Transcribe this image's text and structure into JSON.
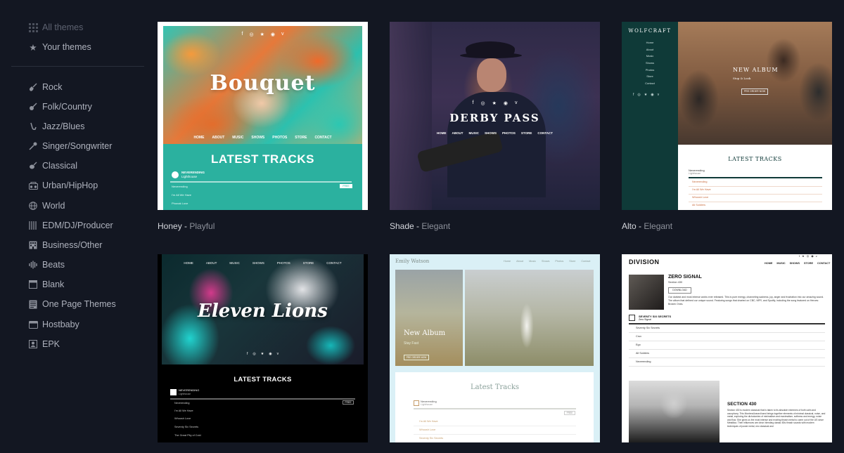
{
  "sidebar": {
    "top": [
      {
        "label": "All themes",
        "icon": "grid-icon"
      },
      {
        "label": "Your themes",
        "icon": "star-icon"
      }
    ],
    "genres": [
      {
        "label": "Rock",
        "icon": "electric-guitar-icon"
      },
      {
        "label": "Folk/Country",
        "icon": "acoustic-guitar-icon"
      },
      {
        "label": "Jazz/Blues",
        "icon": "saxophone-icon"
      },
      {
        "label": "Singer/Songwriter",
        "icon": "microphone-icon"
      },
      {
        "label": "Classical",
        "icon": "violin-icon"
      },
      {
        "label": "Urban/HipHop",
        "icon": "boombox-icon"
      },
      {
        "label": "World",
        "icon": "globe-icon"
      },
      {
        "label": "EDM/DJ/Producer",
        "icon": "mixer-icon"
      },
      {
        "label": "Business/Other",
        "icon": "building-icon"
      },
      {
        "label": "Beats",
        "icon": "waveform-icon"
      },
      {
        "label": "Blank",
        "icon": "blank-page-icon"
      },
      {
        "label": "One Page Themes",
        "icon": "single-page-icon"
      },
      {
        "label": "Hostbaby",
        "icon": "hostbaby-icon"
      },
      {
        "label": "EPK",
        "icon": "id-card-icon"
      }
    ]
  },
  "themes": {
    "honey": {
      "name": "Honey",
      "style": "Playful",
      "preview": {
        "title": "Bouquet",
        "nav": [
          "HOME",
          "ABOUT",
          "MUSIC",
          "SHOWS",
          "PHOTOS",
          "STORE",
          "CONTACT"
        ],
        "section_title": "LATEST TRACKS",
        "player_title": "NEVERENDING",
        "player_sub": "Lighthouse",
        "free_label": "FREE",
        "tracks": [
          "Neverending",
          "I'm All We Have",
          "Phonak Love"
        ]
      }
    },
    "shade": {
      "name": "Shade",
      "style": "Elegant",
      "preview": {
        "title": "DERBY PASS",
        "nav": [
          "HOME",
          "ABOUT",
          "MUSIC",
          "SHOWS",
          "PHOTOS",
          "STORE",
          "CONTACT"
        ]
      }
    },
    "alto": {
      "name": "Alto",
      "style": "Elegant",
      "preview": {
        "brand": "WOLFCRAFT",
        "menu": [
          "Home",
          "About",
          "Music",
          "Shows",
          "Photos",
          "Store",
          "Contact"
        ],
        "hero_title": "NEW ALBUM",
        "hero_sub": "Stop & Look",
        "hero_button": "PRE ORDER NOW",
        "section_title": "LATEST TRACKS",
        "player_title": "Neverending",
        "player_sub": "Lighthouse",
        "tracks": [
          "Neverending",
          "I'm All We Have",
          "Whoosh Love",
          "All Soldiers",
          "Seventy Six Secrets"
        ]
      }
    },
    "eleven": {
      "preview": {
        "title": "Eleven Lions",
        "nav": [
          "HOME",
          "ABOUT",
          "MUSIC",
          "SHOWS",
          "PHOTOS",
          "STORE",
          "CONTACT"
        ],
        "section_title": "LATEST TRACKS",
        "player_title": "NEVERENDING",
        "player_sub": "Lighthouse",
        "free_label": "FREE",
        "tracks": [
          "Neverending",
          "I'm All We Have",
          "Whoosh Love",
          "Seventy Six Secrets",
          "The Great Pity of Cold"
        ]
      }
    },
    "emily": {
      "preview": {
        "brand": "Emily Watson",
        "nav": [
          "Home",
          "About",
          "Music",
          "Shows",
          "Photos",
          "Store",
          "Contact"
        ],
        "hero_title": "New Album",
        "hero_sub": "Stay Fast",
        "hero_button": "PRE ORDER NOW",
        "section_title": "Latest Tracks",
        "player_title": "Neverending",
        "player_sub": "Lighthouse",
        "free_label": "FREE",
        "tracks": [
          "I'm All We Have",
          "Whoosh Love",
          "Seventy Six Secrets"
        ]
      }
    },
    "division": {
      "preview": {
        "brand": "DIVISION",
        "nav": [
          "HOME",
          "MUSIC",
          "SHOWS",
          "STORE",
          "CONTACT"
        ],
        "album_title": "ZERO SIGNAL",
        "album_sub": "Section 430",
        "download_label": "DOWNLOAD",
        "album_desc": "Our darkest and most intense works ever released. This is pure energy, channeling sadness, joy, anger and frustration into our amazing sound. The album that defined our unique sound. Featuring songs that charted on CBC, NPR, and Spotify, including the song featured on Heroes: Broken Ones.",
        "player_title": "SEVENTY SIX SECRETS",
        "player_sub": "Zero Signal",
        "tracks": [
          "Seventy Six Secrets",
          "Crux",
          "Ego",
          "All Soldiers",
          "Neverending"
        ],
        "section2_title": "SECTION 430",
        "section2_desc": "Section 430 is modern classical that is taken to its absolute extremes of both calm and cacophony. This Montreal-based band brings together elements of minimal classical, noise, and metal, exploring the dichotomies of minimalism and maximalism, softness and energy, noise and flow. She gives us the most intense and exciting thrash metal to come out of the US since Metallica. Their influences are clear: blending classic 80s thrash sounds with modern techniques of power metal, neo classical and"
      }
    }
  }
}
